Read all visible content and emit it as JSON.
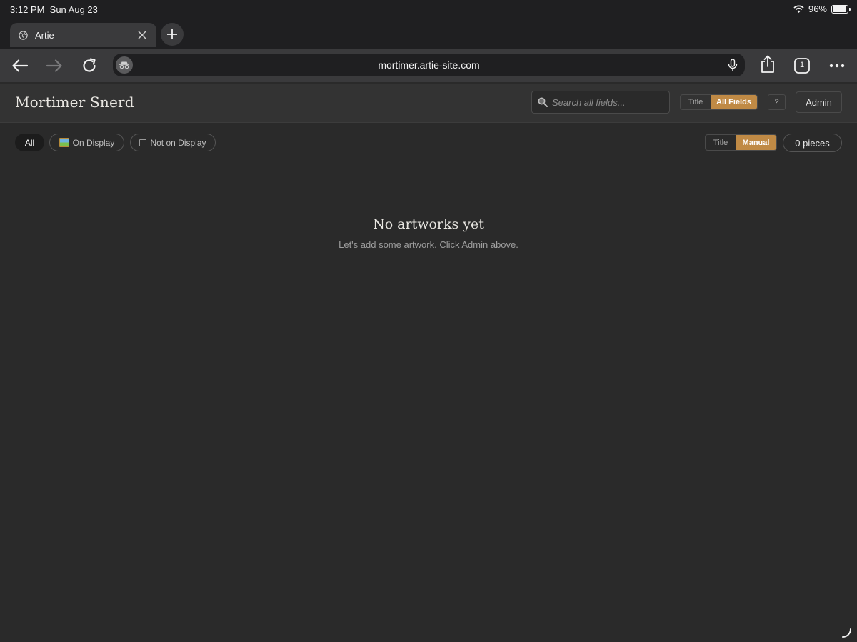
{
  "status_bar": {
    "time": "3:12 PM",
    "date": "Sun Aug 23",
    "battery_percent": "96%",
    "battery_level": 0.96
  },
  "browser": {
    "tab_title": "Artie",
    "url": "mortimer.artie-site.com",
    "tab_count": "1"
  },
  "header": {
    "site_title": "Mortimer Snerd",
    "search_placeholder": "Search all fields...",
    "search_scope": {
      "options": [
        "Title",
        "All Fields"
      ],
      "selected": "All Fields"
    },
    "help_label": "?",
    "admin_label": "Admin"
  },
  "filters": {
    "all_label": "All",
    "on_display_label": "On Display",
    "not_on_display_label": "Not on Display",
    "selected": "All"
  },
  "sort": {
    "options": [
      "Title",
      "Manual"
    ],
    "selected": "Manual"
  },
  "count_label": "0 pieces",
  "empty_state": {
    "title": "No artworks yet",
    "message": "Let's add some artwork. Click Admin above."
  },
  "colors": {
    "accent": "#c08a45",
    "background": "#2a2a2a",
    "header": "#333333"
  }
}
